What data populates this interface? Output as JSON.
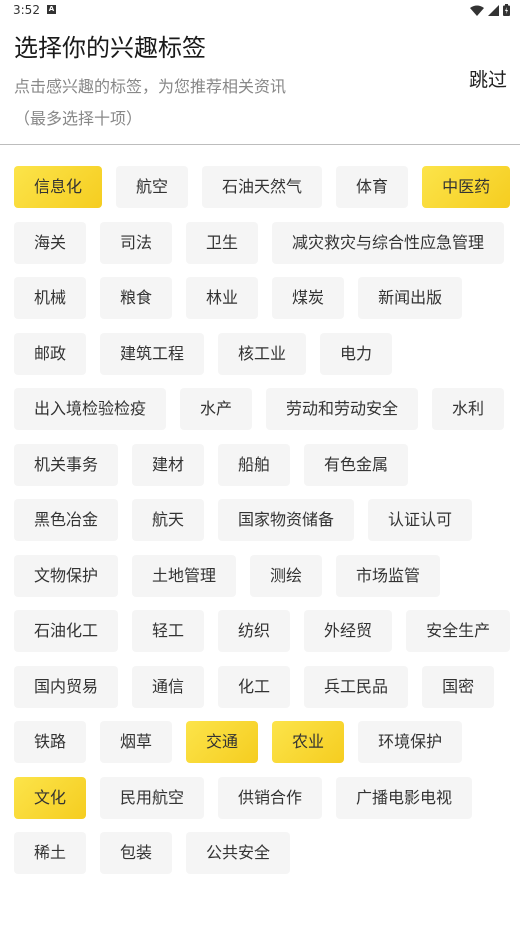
{
  "status": {
    "time": "3:52",
    "notif_letter": "A"
  },
  "header": {
    "title": "选择你的兴趣标签",
    "subtitle": "点击感兴趣的标签，为您推荐相关资讯",
    "hint": "（最多选择十项）",
    "skip_label": "跳过"
  },
  "colors": {
    "selected": "#f8d62f",
    "unselected": "#f5f5f5"
  },
  "tags": [
    {
      "label": "信息化",
      "selected": true
    },
    {
      "label": "航空",
      "selected": false
    },
    {
      "label": "石油天然气",
      "selected": false
    },
    {
      "label": "体育",
      "selected": false
    },
    {
      "label": "中医药",
      "selected": true
    },
    {
      "label": "海关",
      "selected": false
    },
    {
      "label": "司法",
      "selected": false
    },
    {
      "label": "卫生",
      "selected": false
    },
    {
      "label": "减灾救灾与综合性应急管理",
      "selected": false
    },
    {
      "label": "机械",
      "selected": false
    },
    {
      "label": "粮食",
      "selected": false
    },
    {
      "label": "林业",
      "selected": false
    },
    {
      "label": "煤炭",
      "selected": false
    },
    {
      "label": "新闻出版",
      "selected": false
    },
    {
      "label": "邮政",
      "selected": false
    },
    {
      "label": "建筑工程",
      "selected": false
    },
    {
      "label": "核工业",
      "selected": false
    },
    {
      "label": "电力",
      "selected": false
    },
    {
      "label": "出入境检验检疫",
      "selected": false
    },
    {
      "label": "水产",
      "selected": false
    },
    {
      "label": "劳动和劳动安全",
      "selected": false
    },
    {
      "label": "水利",
      "selected": false
    },
    {
      "label": "机关事务",
      "selected": false
    },
    {
      "label": "建材",
      "selected": false
    },
    {
      "label": "船舶",
      "selected": false
    },
    {
      "label": "有色金属",
      "selected": false
    },
    {
      "label": "黑色冶金",
      "selected": false
    },
    {
      "label": "航天",
      "selected": false
    },
    {
      "label": "国家物资储备",
      "selected": false
    },
    {
      "label": "认证认可",
      "selected": false
    },
    {
      "label": "文物保护",
      "selected": false
    },
    {
      "label": "土地管理",
      "selected": false
    },
    {
      "label": "测绘",
      "selected": false
    },
    {
      "label": "市场监管",
      "selected": false
    },
    {
      "label": "石油化工",
      "selected": false
    },
    {
      "label": "轻工",
      "selected": false
    },
    {
      "label": "纺织",
      "selected": false
    },
    {
      "label": "外经贸",
      "selected": false
    },
    {
      "label": "安全生产",
      "selected": false
    },
    {
      "label": "国内贸易",
      "selected": false
    },
    {
      "label": "通信",
      "selected": false
    },
    {
      "label": "化工",
      "selected": false
    },
    {
      "label": "兵工民品",
      "selected": false
    },
    {
      "label": "国密",
      "selected": false
    },
    {
      "label": "铁路",
      "selected": false
    },
    {
      "label": "烟草",
      "selected": false
    },
    {
      "label": "交通",
      "selected": true
    },
    {
      "label": "农业",
      "selected": true
    },
    {
      "label": "环境保护",
      "selected": false
    },
    {
      "label": "文化",
      "selected": true
    },
    {
      "label": "民用航空",
      "selected": false
    },
    {
      "label": "供销合作",
      "selected": false
    },
    {
      "label": "广播电影电视",
      "selected": false
    },
    {
      "label": "稀土",
      "selected": false
    },
    {
      "label": "包装",
      "selected": false
    },
    {
      "label": "公共安全",
      "selected": false
    }
  ]
}
